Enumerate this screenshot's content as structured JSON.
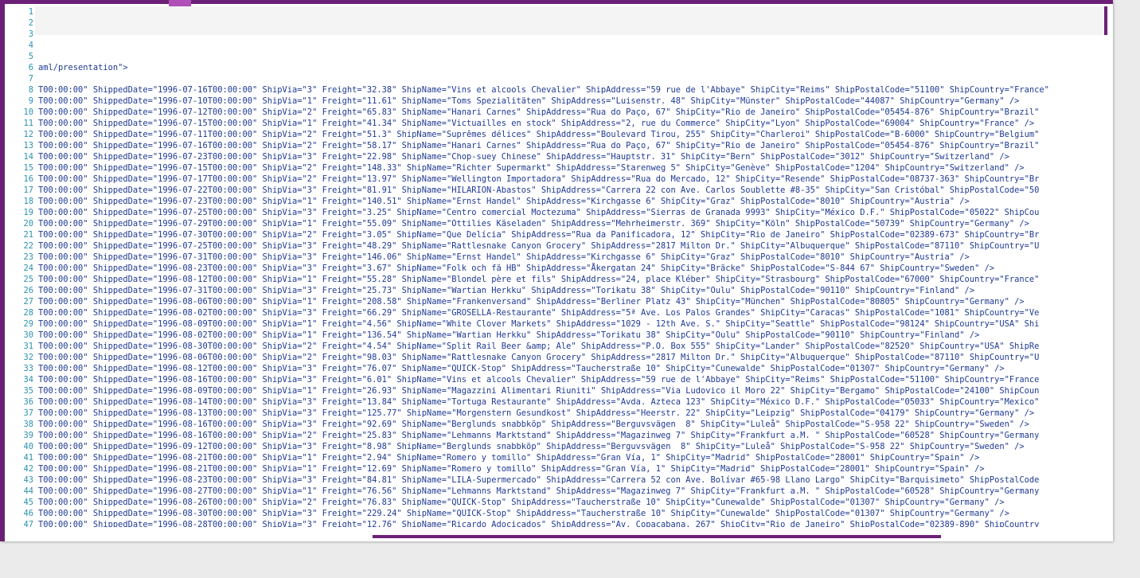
{
  "editor": {
    "line_numbers": [
      "1",
      "2",
      "3",
      "4",
      "5",
      "6",
      "7",
      "8",
      "9",
      "10",
      "11",
      "12",
      "13",
      "14",
      "15",
      "16",
      "17",
      "18",
      "19",
      "20",
      "21",
      "22",
      "23",
      "24",
      "25",
      "26",
      "27",
      "28",
      "29",
      "30",
      "31",
      "32",
      "33",
      "34",
      "35",
      "36",
      "37",
      "38",
      "39",
      "40",
      "41",
      "42",
      "43",
      "44",
      "45",
      "46",
      "47"
    ],
    "lines": [
      "",
      "",
      "",
      "",
      "",
      "aml/presentation\">",
      "",
      "T00:00:00\" ShippedDate=\"1996-07-16T00:00:00\" ShipVia=\"3\" Freight=\"32.38\" ShipName=\"Vins et alcools Chevalier\" ShipAddress=\"59 rue de l'Abbaye\" ShipCity=\"Reims\" ShipPostalCode=\"51100\" ShipCountry=\"France\"",
      "T00:00:00\" ShippedDate=\"1996-07-10T00:00:00\" ShipVia=\"1\" Freight=\"11.61\" ShipName=\"Toms Spezialitäten\" ShipAddress=\"Luisenstr. 48\" ShipCity=\"Münster\" ShipPostalCode=\"44087\" ShipCountry=\"Germany\" />",
      "T00:00:00\" ShippedDate=\"1996-07-12T00:00:00\" ShipVia=\"2\" Freight=\"65.83\" ShipName=\"Hanari Carnes\" ShipAddress=\"Rua do Paço, 67\" ShipCity=\"Rio de Janeiro\" ShipPostalCode=\"05454-876\" ShipCountry=\"Brazil\"",
      "T00:00:00\" ShippedDate=\"1996-07-15T00:00:00\" ShipVia=\"1\" Freight=\"41.34\" ShipName=\"Victuailles en stock\" ShipAddress=\"2, rue du Commerce\" ShipCity=\"Lyon\" ShipPostalCode=\"69004\" ShipCountry=\"France\" />",
      "T00:00:00\" ShippedDate=\"1996-07-11T00:00:00\" ShipVia=\"2\" Freight=\"51.3\" ShipName=\"Suprêmes délices\" ShipAddress=\"Boulevard Tirou, 255\" ShipCity=\"Charleroi\" ShipPostalCode=\"B-6000\" ShipCountry=\"Belgium\"",
      "T00:00:00\" ShippedDate=\"1996-07-16T00:00:00\" ShipVia=\"2\" Freight=\"58.17\" ShipName=\"Hanari Carnes\" ShipAddress=\"Rua do Paço, 67\" ShipCity=\"Rio de Janeiro\" ShipPostalCode=\"05454-876\" ShipCountry=\"Brazil\"",
      "T00:00:00\" ShippedDate=\"1996-07-23T00:00:00\" ShipVia=\"3\" Freight=\"22.98\" ShipName=\"Chop-suey Chinese\" ShipAddress=\"Hauptstr. 31\" ShipCity=\"Bern\" ShipPostalCode=\"3012\" ShipCountry=\"Switzerland\" />",
      "T00:00:00\" ShippedDate=\"1996-07-15T00:00:00\" ShipVia=\"2\" Freight=\"148.33\" ShipName=\"Richter Supermarkt\" ShipAddress=\"Starenweg 5\" ShipCity=\"Genève\" ShipPostalCode=\"1204\" ShipCountry=\"Switzerland\" />",
      "T00:00:00\" ShippedDate=\"1996-07-17T00:00:00\" ShipVia=\"2\" Freight=\"13.97\" ShipName=\"Wellington Importadora\" ShipAddress=\"Rua do Mercado, 12\" ShipCity=\"Resende\" ShipPostalCode=\"08737-363\" ShipCountry=\"Br",
      "T00:00:00\" ShippedDate=\"1996-07-22T00:00:00\" ShipVia=\"3\" Freight=\"81.91\" ShipName=\"HILARION-Abastos\" ShipAddress=\"Carrera 22 con Ave. Carlos Soublette #8-35\" ShipCity=\"San Cristóbal\" ShipPostalCode=\"50",
      "T00:00:00\" ShippedDate=\"1996-07-23T00:00:00\" ShipVia=\"1\" Freight=\"140.51\" ShipName=\"Ernst Handel\" ShipAddress=\"Kirchgasse 6\" ShipCity=\"Graz\" ShipPostalCode=\"8010\" ShipCountry=\"Austria\" />",
      "T00:00:00\" ShippedDate=\"1996-07-25T00:00:00\" ShipVia=\"3\" Freight=\"3.25\" ShipName=\"Centro comercial Moctezuma\" ShipAddress=\"Sierras de Granada 9993\" ShipCity=\"México D.F.\" ShipPostalCode=\"05022\" ShipCou",
      "T00:00:00\" ShippedDate=\"1996-07-29T00:00:00\" ShipVia=\"1\" Freight=\"55.09\" ShipName=\"Ottilies Käseladen\" ShipAddress=\"Mehrheimerstr. 369\" ShipCity=\"Köln\" ShipPostalCode=\"50739\" ShipCountry=\"Germany\" />",
      "T00:00:00\" ShippedDate=\"1996-07-30T00:00:00\" ShipVia=\"2\" Freight=\"3.05\" ShipName=\"Que Delícia\" ShipAddress=\"Rua da Panificadora, 12\" ShipCity=\"Rio de Janeiro\" ShipPostalCode=\"02389-673\" ShipCountry=\"Br",
      "T00:00:00\" ShippedDate=\"1996-07-25T00:00:00\" ShipVia=\"3\" Freight=\"48.29\" ShipName=\"Rattlesnake Canyon Grocery\" ShipAddress=\"2817 Milton Dr.\" ShipCity=\"Albuquerque\" ShipPostalCode=\"87110\" ShipCountry=\"U",
      "T00:00:00\" ShippedDate=\"1996-07-31T00:00:00\" ShipVia=\"3\" Freight=\"146.06\" ShipName=\"Ernst Handel\" ShipAddress=\"Kirchgasse 6\" ShipCity=\"Graz\" ShipPostalCode=\"8010\" ShipCountry=\"Austria\" />",
      "T00:00:00\" ShippedDate=\"1996-08-23T00:00:00\" ShipVia=\"3\" Freight=\"3.67\" ShipName=\"Folk och fä HB\" ShipAddress=\"Åkergatan 24\" ShipCity=\"Bräcke\" ShipPostalCode=\"S-844 67\" ShipCountry=\"Sweden\" />",
      "T00:00:00\" ShippedDate=\"1996-08-12T00:00:00\" ShipVia=\"1\" Freight=\"55.28\" ShipName=\"Blondel père et fils\" ShipAddress=\"24, place Kléber\" ShipCity=\"Strasbourg\" ShipPostalCode=\"67000\" ShipCountry=\"France\"",
      "T00:00:00\" ShippedDate=\"1996-07-31T00:00:00\" ShipVia=\"3\" Freight=\"25.73\" ShipName=\"Wartian Herkku\" ShipAddress=\"Torikatu 38\" ShipCity=\"Oulu\" ShipPostalCode=\"90110\" ShipCountry=\"Finland\" />",
      "T00:00:00\" ShippedDate=\"1996-08-06T00:00:00\" ShipVia=\"1\" Freight=\"208.58\" ShipName=\"Frankenversand\" ShipAddress=\"Berliner Platz 43\" ShipCity=\"München\" ShipPostalCode=\"80805\" ShipCountry=\"Germany\" />",
      "T00:00:00\" ShippedDate=\"1996-08-02T00:00:00\" ShipVia=\"3\" Freight=\"66.29\" ShipName=\"GROSELLA-Restaurante\" ShipAddress=\"5ª Ave. Los Palos Grandes\" ShipCity=\"Caracas\" ShipPostalCode=\"1081\" ShipCountry=\"Ve",
      "T00:00:00\" ShippedDate=\"1996-08-09T00:00:00\" ShipVia=\"1\" Freight=\"4.56\" ShipName=\"White Clover Markets\" ShipAddress=\"1029 - 12th Ave. S.\" ShipCity=\"Seattle\" ShipPostalCode=\"98124\" ShipCountry=\"USA\" Shi",
      "T00:00:00\" ShippedDate=\"1996-08-02T00:00:00\" ShipVia=\"1\" Freight=\"136.54\" ShipName=\"Wartian Herkku\" ShipAddress=\"Torikatu 38\" ShipCity=\"Oulu\" ShipPostalCode=\"90110\" ShipCountry=\"Finland\" />",
      "T00:00:00\" ShippedDate=\"1996-08-30T00:00:00\" ShipVia=\"2\" Freight=\"4.54\" ShipName=\"Split Rail Beer &amp; Ale\" ShipAddress=\"P.O. Box 555\" ShipCity=\"Lander\" ShipPostalCode=\"82520\" ShipCountry=\"USA\" ShipRe",
      "T00:00:00\" ShippedDate=\"1996-08-06T00:00:00\" ShipVia=\"2\" Freight=\"98.03\" ShipName=\"Rattlesnake Canyon Grocery\" ShipAddress=\"2817 Milton Dr.\" ShipCity=\"Albuquerque\" ShipPostalCode=\"87110\" ShipCountry=\"U",
      "T00:00:00\" ShippedDate=\"1996-08-12T00:00:00\" ShipVia=\"3\" Freight=\"76.07\" ShipName=\"QUICK-Stop\" ShipAddress=\"Taucherstraße 10\" ShipCity=\"Cunewalde\" ShipPostalCode=\"01307\" ShipCountry=\"Germany\" />",
      "T00:00:00\" ShippedDate=\"1996-08-16T00:00:00\" ShipVia=\"3\" Freight=\"6.01\" ShipName=\"Vins et alcools Chevalier\" ShipAddress=\"59 rue de l'Abbaye\" ShipCity=\"Reims\" ShipPostalCode=\"51100\" ShipCountry=\"France",
      "T00:00:00\" ShippedDate=\"1996-08-09T00:00:00\" ShipVia=\"1\" Freight=\"26.93\" ShipName=\"Magazzini Alimentari Riuniti\" ShipAddress=\"Via Ludovico il Moro 22\" ShipCity=\"Bergamo\" ShipPostalCode=\"24100\" ShipCoun",
      "T00:00:00\" ShippedDate=\"1996-08-14T00:00:00\" ShipVia=\"3\" Freight=\"13.84\" ShipName=\"Tortuga Restaurante\" ShipAddress=\"Avda. Azteca 123\" ShipCity=\"México D.F.\" ShipPostalCode=\"05033\" ShipCountry=\"Mexico\"",
      "T00:00:00\" ShippedDate=\"1996-08-13T00:00:00\" ShipVia=\"3\" Freight=\"125.77\" ShipName=\"Morgenstern Gesundkost\" ShipAddress=\"Heerstr. 22\" ShipCity=\"Leipzig\" ShipPostalCode=\"04179\" ShipCountry=\"Germany\" />",
      "T00:00:00\" ShippedDate=\"1996-08-16T00:00:00\" ShipVia=\"3\" Freight=\"92.69\" ShipName=\"Berglunds snabbköp\" ShipAddress=\"Berguvsvägen  8\" ShipCity=\"Luleå\" ShipPostalCode=\"S-958 22\" ShipCountry=\"Sweden\" />",
      "T00:00:00\" ShippedDate=\"1996-08-16T00:00:00\" ShipVia=\"2\" Freight=\"25.83\" ShipName=\"Lehmanns Marktstand\" ShipAddress=\"Magazinweg 7\" ShipCity=\"Frankfurt a.M. \" ShipPostalCode=\"60528\" ShipCountry=\"Germany",
      "T00:00:00\" ShippedDate=\"1996-09-12T00:00:00\" ShipVia=\"3\" Freight=\"8.98\" ShipName=\"Berglunds snabbköp\" ShipAddress=\"Berguvsvägen  8\" ShipCity=\"Luleå\" ShipPostalCode=\"S-958 22\" ShipCountry=\"Sweden\" />",
      "T00:00:00\" ShippedDate=\"1996-08-21T00:00:00\" ShipVia=\"1\" Freight=\"2.94\" ShipName=\"Romero y tomillo\" ShipAddress=\"Gran Vía, 1\" ShipCity=\"Madrid\" ShipPostalCode=\"28001\" ShipCountry=\"Spain\" />",
      "T00:00:00\" ShippedDate=\"1996-08-21T00:00:00\" ShipVia=\"1\" Freight=\"12.69\" ShipName=\"Romero y tomillo\" ShipAddress=\"Gran Vía, 1\" ShipCity=\"Madrid\" ShipPostalCode=\"28001\" ShipCountry=\"Spain\" />",
      "T00:00:00\" ShippedDate=\"1996-08-23T00:00:00\" ShipVia=\"3\" Freight=\"84.81\" ShipName=\"LILA-Supermercado\" ShipAddress=\"Carrera 52 con Ave. Bolívar #65-98 Llano Largo\" ShipCity=\"Barquisimeto\" ShipPostalCode",
      "T00:00:00\" ShippedDate=\"1996-08-27T00:00:00\" ShipVia=\"1\" Freight=\"76.56\" ShipName=\"Lehmanns Marktstand\" ShipAddress=\"Magazinweg 7\" ShipCity=\"Frankfurt a.M. \" ShipPostalCode=\"60528\" ShipCountry=\"Germany",
      "T00:00:00\" ShippedDate=\"1996-08-26T00:00:00\" ShipVia=\"2\" Freight=\"76.83\" ShipName=\"QUICK-Stop\" ShipAddress=\"Taucherstraße 10\" ShipCity=\"Cunewalde\" ShipPostalCode=\"01307\" ShipCountry=\"Germany\" />",
      "T00:00:00\" ShippedDate=\"1996-08-30T00:00:00\" ShipVia=\"3\" Freight=\"229.24\" ShipName=\"QUICK-Stop\" ShipAddress=\"Taucherstraße 10\" ShipCity=\"Cunewalde\" ShipPostalCode=\"01307\" ShipCountry=\"Germany\" />",
      "T00:00:00\" ShippedDate=\"1996-08-28T00:00:00\" ShipVia=\"3\" Freight=\"12.76\" ShipName=\"Ricardo Adocicados\" ShipAddress=\"Av. Copacabana, 267\" ShipCity=\"Rio de Janeiro\" ShipPostalCode=\"02389-890\" ShipCountry"
    ]
  },
  "theme": {
    "accent": "#6d2077",
    "accent_light": "#b04fb8",
    "line_number_color": "#2b91af",
    "text_color": "#1f3a93"
  }
}
